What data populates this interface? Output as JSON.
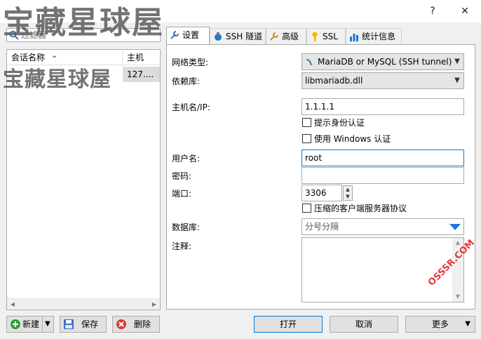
{
  "window": {
    "help_label": "?",
    "close_label": "✕",
    "watermark": "宝藏星球屋",
    "watermark_site": "OSSSR.COM"
  },
  "sidebar": {
    "filter_placeholder": "过滤器",
    "columns": [
      "会话名称",
      "主机"
    ],
    "sort_indicator": "^",
    "sessions": [
      {
        "name": "",
        "host": "127...."
      }
    ],
    "buttons": {
      "new": "新建",
      "save": "保存",
      "delete": "删除"
    }
  },
  "tabs": [
    {
      "label": "设置",
      "icon": "wrench-icon",
      "active": true
    },
    {
      "label": "SSH 隧道",
      "icon": "ssh-icon",
      "active": false
    },
    {
      "label": "高级",
      "icon": "wrench-icon",
      "active": false
    },
    {
      "label": "SSL",
      "icon": "key-icon",
      "active": false
    },
    {
      "label": "统计信息",
      "icon": "stats-icon",
      "active": false
    }
  ],
  "settings": {
    "network_type_label": "网络类型:",
    "network_type_value": "MariaDB or MySQL (SSH tunnel)",
    "library_label": "依赖库:",
    "library_value": "libmariadb.dll",
    "host_label": "主机名/IP:",
    "host_value": "1.1.1.1",
    "prompt_auth_label": "提示身份认证",
    "windows_auth_label": "使用 Windows 认证",
    "user_label": "用户名:",
    "user_value": "root",
    "password_label": "密码:",
    "password_value": "",
    "port_label": "端口:",
    "port_value": "3306",
    "compress_label": "压缩的客户端服务器协议",
    "database_label": "数据库:",
    "database_placeholder": "分号分隔",
    "comment_label": "注释:",
    "comment_value": ""
  },
  "footer": {
    "open": "打开",
    "cancel": "取消",
    "more": "更多"
  },
  "colors": {
    "accent": "#0078d7",
    "dropdown_triangle": "#1e78d8"
  }
}
